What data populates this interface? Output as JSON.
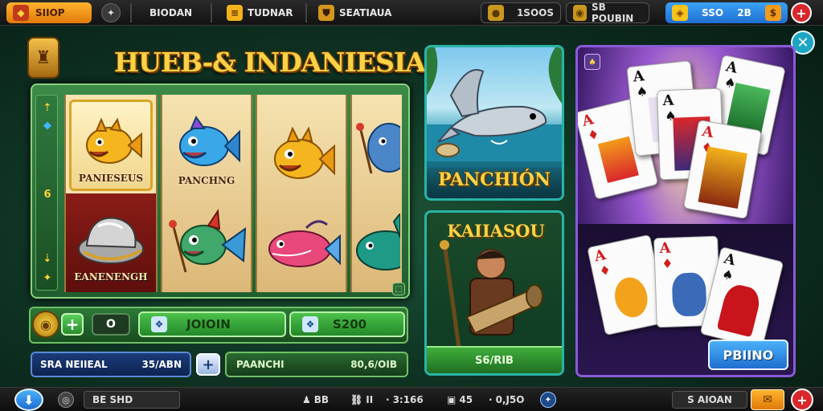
{
  "topbar": {
    "shop_label": "SIIOP",
    "tab1_label": "BIODAN",
    "tab2_label": "TUDNAR",
    "tab3_label": "SEATIAUA",
    "coins_value": "1SOOS",
    "currency_label": "SB POUBIN",
    "balance_label": "SSO",
    "balance_value": "2B"
  },
  "game": {
    "title": "HUEB-& INDANIESIA",
    "side_marks": [
      "6"
    ]
  },
  "reels": {
    "symbols": [
      {
        "label": "PANIESEUS",
        "icon": "golden-fish-icon"
      },
      {
        "label": "PANCHNG",
        "icon": "blue-fish-icon"
      },
      {
        "label": "",
        "icon": "golden-fish-icon"
      },
      {
        "label": "",
        "icon": "blue-fish-icon"
      },
      {
        "label": "EANENENGH",
        "icon": "silver-hat-icon"
      },
      {
        "label": "",
        "icon": "green-fish-icon"
      },
      {
        "label": "",
        "icon": "pink-fish-icon"
      },
      {
        "label": "",
        "icon": "teal-fish-icon"
      }
    ]
  },
  "controls": {
    "bet_value": "O",
    "win_value": "JOIOIN",
    "credit_value": "S200",
    "left_info_label": "SRA NEIIEAL",
    "left_info_value": "35/ABN",
    "right_info_label": "PAANCHI",
    "right_info_value": "80,6/OIB"
  },
  "games": {
    "card1_title": "PANCHIÓN",
    "card2_title": "KAIIASOU",
    "card2_value": "S6/RIB",
    "poker_button": "PBIINO"
  },
  "bottombar": {
    "search_label": "BE SHD",
    "players": "BB",
    "stat1": "II",
    "time": "3:166",
    "stat2": "45",
    "stat3": "0,J5O",
    "right_label": "S AIOAN"
  },
  "colors": {
    "gold": "#f8d346",
    "green_button": "#3fae3c",
    "blue_button": "#2f8fe8",
    "red_button": "#d9272b",
    "orange_button": "#f3a21b"
  }
}
